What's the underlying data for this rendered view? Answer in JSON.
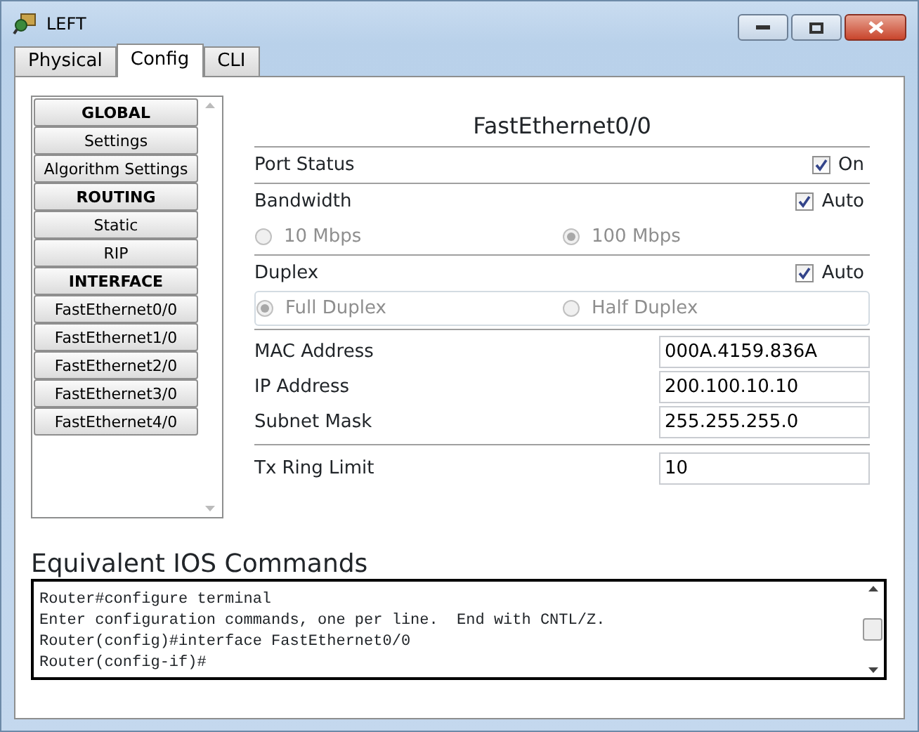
{
  "window": {
    "title": "LEFT"
  },
  "tabs": [
    {
      "label": "Physical",
      "selected": false
    },
    {
      "label": "Config",
      "selected": true
    },
    {
      "label": "CLI",
      "selected": false
    }
  ],
  "sidebar": {
    "items": [
      {
        "kind": "header",
        "label": "GLOBAL"
      },
      {
        "kind": "item",
        "label": "Settings"
      },
      {
        "kind": "item",
        "label": "Algorithm Settings"
      },
      {
        "kind": "header",
        "label": "ROUTING"
      },
      {
        "kind": "item",
        "label": "Static"
      },
      {
        "kind": "item",
        "label": "RIP"
      },
      {
        "kind": "header",
        "label": "INTERFACE"
      },
      {
        "kind": "item",
        "label": "FastEthernet0/0"
      },
      {
        "kind": "item",
        "label": "FastEthernet1/0"
      },
      {
        "kind": "item",
        "label": "FastEthernet2/0"
      },
      {
        "kind": "item",
        "label": "FastEthernet3/0"
      },
      {
        "kind": "item",
        "label": "FastEthernet4/0"
      }
    ]
  },
  "interface": {
    "title": "FastEthernet0/0",
    "port_status": {
      "label": "Port Status",
      "checkbox_label": "On",
      "checked": true
    },
    "bandwidth": {
      "label": "Bandwidth",
      "checkbox_label": "Auto",
      "checked": true,
      "options": [
        {
          "label": "10 Mbps",
          "selected": false,
          "disabled": true
        },
        {
          "label": "100 Mbps",
          "selected": true,
          "disabled": true
        }
      ]
    },
    "duplex": {
      "label": "Duplex",
      "checkbox_label": "Auto",
      "checked": true,
      "options": [
        {
          "label": "Full Duplex",
          "selected": true,
          "disabled": true
        },
        {
          "label": "Half Duplex",
          "selected": false,
          "disabled": true
        }
      ]
    },
    "fields": [
      {
        "label": "MAC Address",
        "value": "000A.4159.836A"
      },
      {
        "label": "IP Address",
        "value": "200.100.10.10"
      },
      {
        "label": "Subnet Mask",
        "value": "255.255.255.0"
      }
    ],
    "tx_ring_limit": {
      "label": "Tx Ring Limit",
      "value": "10"
    }
  },
  "console": {
    "title": "Equivalent IOS Commands",
    "lines": [
      "Router#configure terminal",
      "Enter configuration commands, one per line.  End with CNTL/Z.",
      "Router(config)#interface FastEthernet0/0",
      "Router(config-if)#"
    ]
  }
}
